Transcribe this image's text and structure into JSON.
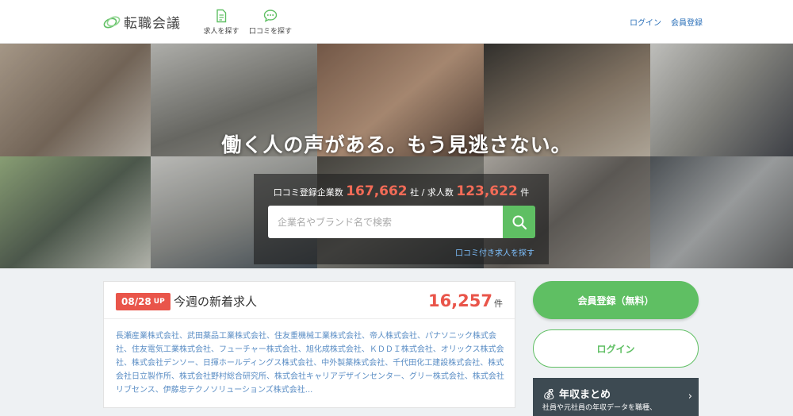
{
  "header": {
    "logo_text": "転職会議",
    "nav": [
      {
        "label": "求人を探す",
        "icon": "document-icon"
      },
      {
        "label": "口コミを探す",
        "icon": "speech-bubble-icon"
      }
    ],
    "login": "ログイン",
    "register": "会員登録"
  },
  "hero": {
    "title": "働く人の声がある。もう見逃さない。",
    "stats": {
      "reviews_label": "口コミ登録企業数",
      "reviews_count": "167,662",
      "reviews_unit": "社",
      "separator": "/",
      "jobs_label": "求人数",
      "jobs_count": "123,622",
      "jobs_unit": "件"
    },
    "search": {
      "placeholder": "企業名やブランド名で検索"
    },
    "reviews_link": "口コミ付き求人を探す"
  },
  "new_jobs": {
    "date": "08/28",
    "badge_suffix": "UP",
    "title": "今週の新着求人",
    "count": "16,257",
    "count_unit": "件",
    "companies": "長瀬産業株式会社、武田薬品工業株式会社、住友重機械工業株式会社、帝人株式会社、パナソニック株式会社、住友電気工業株式会社、フューチャー株式会社、旭化成株式会社、ＫＤＤＩ株式会社、オリックス株式会社、株式会社デンソー、日揮ホールディングス株式会社、中外製薬株式会社、千代田化工建設株式会社、株式会社日立製作所、株式会社野村総合研究所、株式会社キャリアデザインセンター、グリー株式会社、株式会社リブセンス、伊藤忠テクノソリューションズ株式会社..."
  },
  "sidebar": {
    "register_button": "会員登録（無料）",
    "login_button": "ログイン",
    "banner": {
      "title": "年収まとめ",
      "subtitle": "社員や元社員の年収データを職種、"
    }
  },
  "colors": {
    "accent_green": "#5fbf63",
    "count_red": "#e9554a",
    "link_blue": "#2a6fb8"
  }
}
